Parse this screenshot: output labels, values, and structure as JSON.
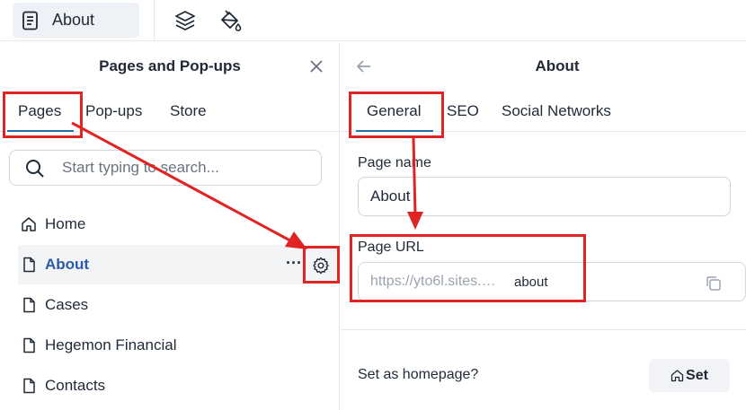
{
  "topbar": {
    "page_select_label": "About",
    "icons": [
      "page-icon",
      "layers-icon",
      "paint-bucket-icon"
    ]
  },
  "left_panel": {
    "title": "Pages and Pop-ups",
    "tabs": [
      {
        "label": "Pages",
        "active": true
      },
      {
        "label": "Pop-ups",
        "active": false
      },
      {
        "label": "Store",
        "active": false
      }
    ],
    "search": {
      "placeholder": "Start typing to search..."
    },
    "items": [
      {
        "label": "Home",
        "icon": "home-icon",
        "active": false
      },
      {
        "label": "About",
        "icon": "page-icon",
        "active": true
      },
      {
        "label": "Cases",
        "icon": "page-icon",
        "active": false
      },
      {
        "label": "Hegemon Financial",
        "icon": "page-icon",
        "active": false
      },
      {
        "label": "Contacts",
        "icon": "page-icon",
        "active": false
      }
    ],
    "more_label": "···"
  },
  "right_panel": {
    "title": "About",
    "tabs": [
      {
        "label": "General",
        "active": true
      },
      {
        "label": "SEO",
        "active": false
      },
      {
        "label": "Social Networks",
        "active": false
      }
    ],
    "page_name": {
      "label": "Page name",
      "value": "About"
    },
    "page_url": {
      "label": "Page URL",
      "prefix": "https://yto6l.sites.…",
      "slug": "about"
    },
    "homepage": {
      "label": "Set as homepage?",
      "button_label": "Set"
    }
  },
  "colors": {
    "accent": "#2b6cb0",
    "active_text": "#2b5aa8",
    "annotation_red": "#e02424"
  }
}
